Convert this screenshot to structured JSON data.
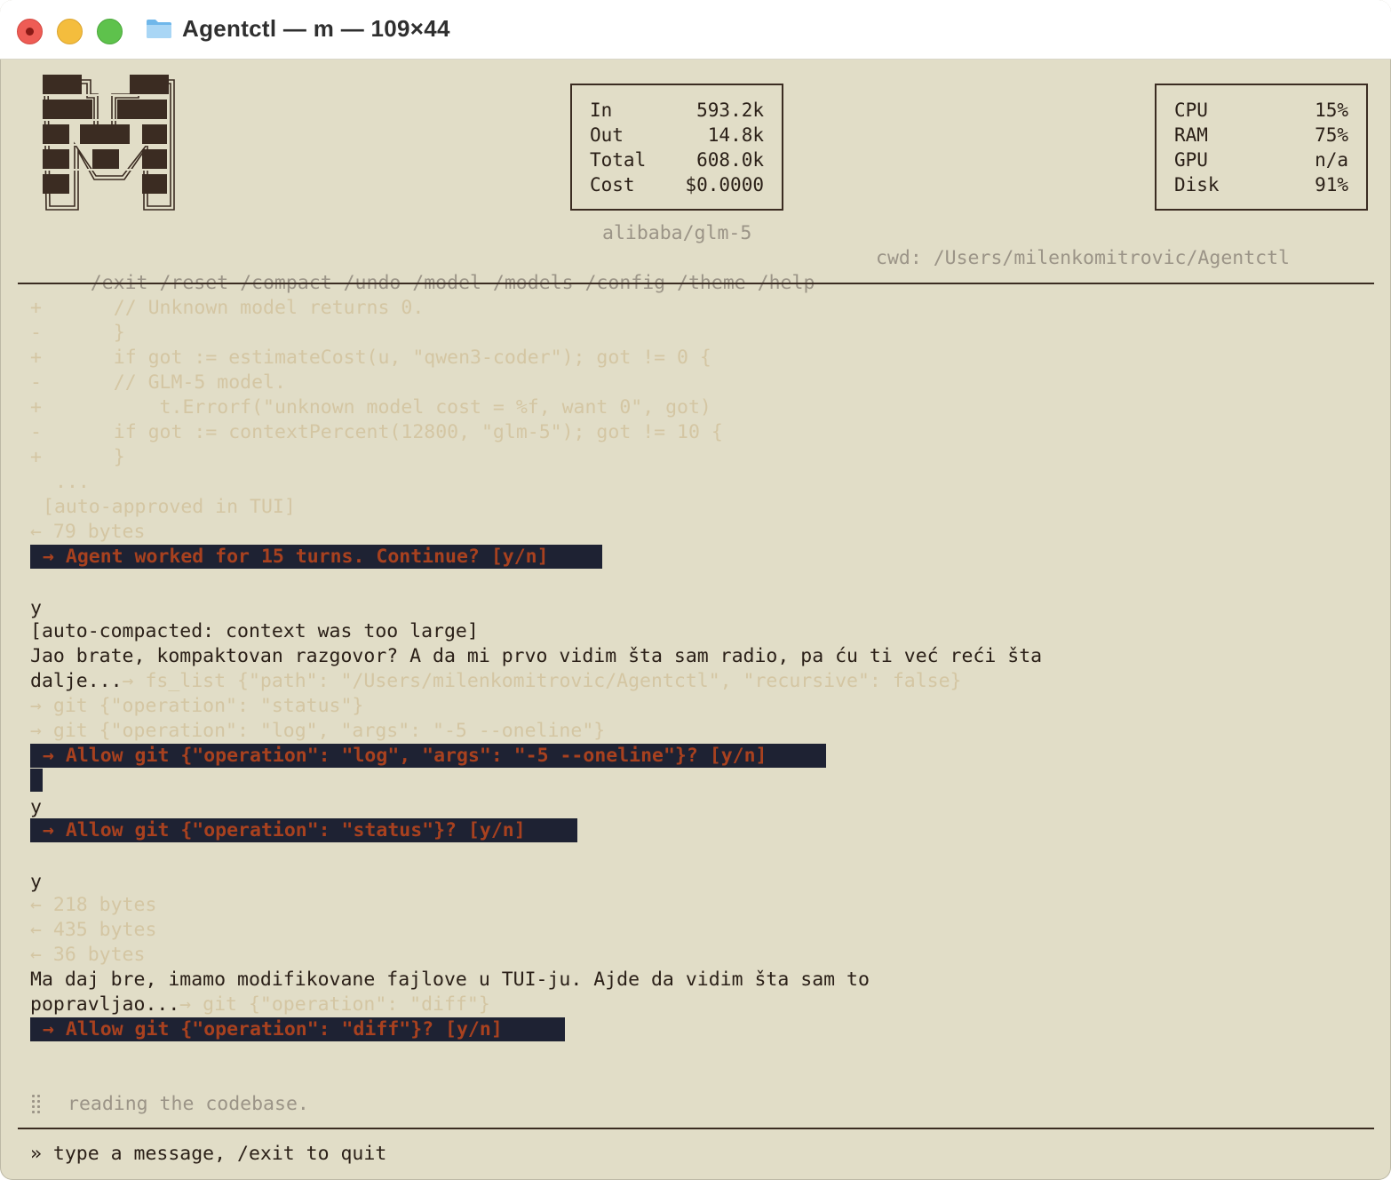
{
  "window": {
    "title": "Agentctl — m — 109×44"
  },
  "stats": {
    "tokens": [
      {
        "label": "In",
        "value": "593.2k"
      },
      {
        "label": "Out",
        "value": "14.8k"
      },
      {
        "label": "Total",
        "value": "608.0k"
      },
      {
        "label": "Cost",
        "value": "$0.0000"
      }
    ],
    "system": [
      {
        "label": "CPU",
        "value": "15%"
      },
      {
        "label": "RAM",
        "value": "75%"
      },
      {
        "label": "GPU",
        "value": "n/a"
      },
      {
        "label": "Disk",
        "value": "91%"
      }
    ]
  },
  "model": "alibaba/glm-5",
  "commands": [
    "/exit",
    "/reset",
    "/compact",
    "/undo",
    "/model",
    "/models",
    "/config",
    "/theme",
    "/help"
  ],
  "cwd": "cwd: /Users/milenkomitrovic/Agentctl",
  "diff_lines": [
    {
      "sign": "+",
      "code": "    // Unknown model returns 0."
    },
    {
      "sign": "-",
      "code": "    }"
    },
    {
      "sign": "+",
      "code": "    if got := estimateCost(u, \"qwen3-coder\"); got != 0 {"
    },
    {
      "sign": "-",
      "code": "    // GLM-5 model."
    },
    {
      "sign": "+",
      "code": "        t.Errorf(\"unknown model cost = %f, want 0\", got)"
    },
    {
      "sign": "-",
      "code": "    if got := contextPercent(12800, \"glm-5\"); got != 10 {"
    },
    {
      "sign": "+",
      "code": "    }"
    }
  ],
  "log": {
    "ellipsis": "...",
    "auto_approved": "[auto-approved in TUI]",
    "bytes_79": "← 79 bytes",
    "prompt_continue": "→ Agent worked for 15 turns. Continue? [y/n]",
    "answer_1": "y",
    "auto_compacted": "[auto-compacted: context was too large]",
    "msg_1_line_1": "Jao brate, kompaktovan razgovor? A da mi prvo vidim šta sam radio, pa ću ti već reći šta",
    "msg_1_line_2": "dalje...",
    "tool_fs_list": "→ fs_list {\"path\": \"/Users/milenkomitrovic/Agentctl\", \"recursive\": false}",
    "tool_git_status": "→ git {\"operation\": \"status\"}",
    "tool_git_log": "→ git {\"operation\": \"log\", \"args\": \"-5 --oneline\"}",
    "prompt_allow_log": "→ Allow git {\"operation\": \"log\", \"args\": \"-5 --oneline\"}? [y/n]",
    "answer_2": "y",
    "prompt_allow_status": "→ Allow git {\"operation\": \"status\"}? [y/n]",
    "answer_3": "y",
    "bytes_218": "← 218 bytes",
    "bytes_435": "← 435 bytes",
    "bytes_36": "← 36 bytes",
    "msg_2_line_1": "Ma daj bre, imamo modifikovane fajlove u TUI-ju. Ajde da vidim šta sam to",
    "msg_2_line_2": "popravljao...",
    "tool_git_diff": "→ git {\"operation\": \"diff\"}",
    "prompt_allow_diff": "→ Allow git {\"operation\": \"diff\"}? [y/n]"
  },
  "status": "reading the codebase.",
  "input": {
    "placeholder": "» type a message, /exit to quit"
  },
  "icons": {
    "logo": "agentctl-m-logo",
    "folder": "folder-icon",
    "spinner": "braille-spinner-icon"
  }
}
